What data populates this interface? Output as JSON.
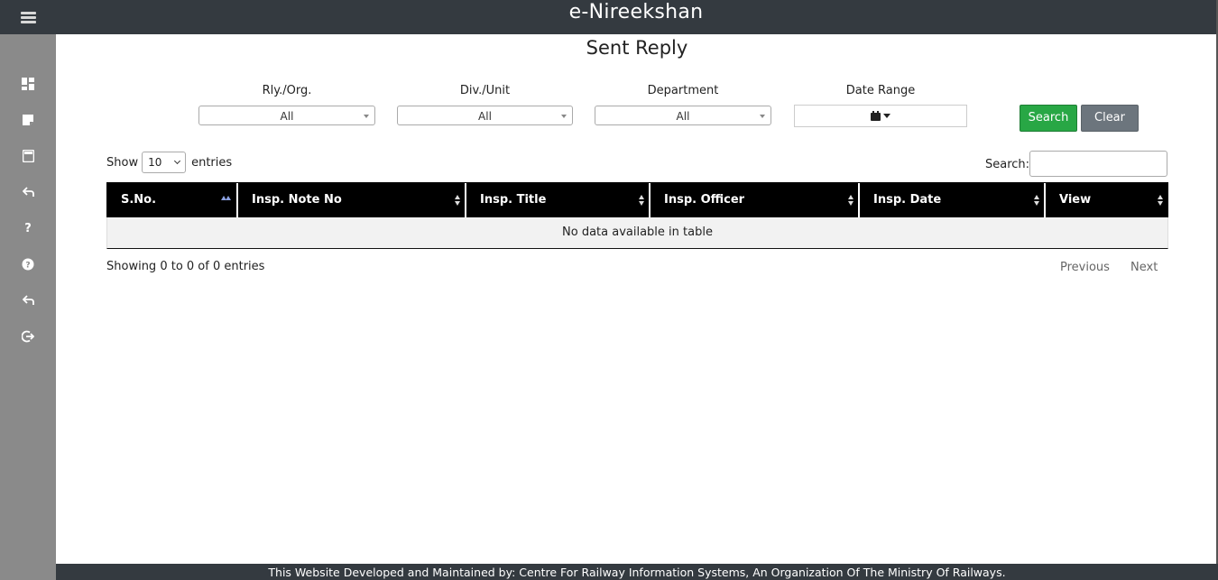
{
  "header": {
    "app_title": "e-Nireekshan"
  },
  "page": {
    "title": "Sent Reply"
  },
  "filters": {
    "rly_org": {
      "label": "Rly./Org.",
      "value": "All"
    },
    "div_unit": {
      "label": "Div./Unit",
      "value": "All"
    },
    "department": {
      "label": "Department",
      "value": "All"
    },
    "date_range": {
      "label": "Date Range"
    }
  },
  "buttons": {
    "search": "Search",
    "clear": "Clear"
  },
  "length_menu": {
    "show": "Show",
    "value": "10",
    "entries": "entries"
  },
  "table_search": {
    "label": "Search:"
  },
  "table": {
    "columns": [
      "S.No.",
      "Insp. Note No",
      "Insp. Title",
      "Insp. Officer",
      "Insp. Date",
      "View"
    ],
    "empty_message": "No data available in table"
  },
  "info": "Showing 0 to 0 of 0 entries",
  "pagination": {
    "previous": "Previous",
    "next": "Next"
  },
  "footer": {
    "text": "This Website Developed and Maintained by: Centre For Railway Information Systems, An Organization Of The Ministry Of Railways."
  },
  "sidebar": {
    "icons": [
      "menu-icon",
      "dashboard-icon",
      "note-icon",
      "save-icon",
      "reply-icon",
      "help-icon",
      "question-circle-icon",
      "reply-icon",
      "logout-icon"
    ]
  },
  "colors": {
    "header_bg": "#343a40",
    "sidebar_bg": "#8a8a8a",
    "search_btn": "#28a745",
    "clear_btn": "#6c757d",
    "table_head": "#000000"
  }
}
